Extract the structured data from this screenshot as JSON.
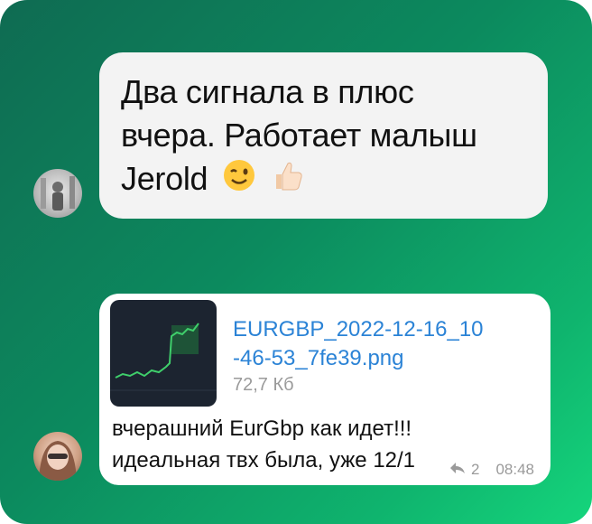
{
  "messages": [
    {
      "text_lines": [
        "Два сигнала в плюс",
        "вчера. Работает малыш",
        "Jerold"
      ],
      "emojis": [
        "winking-face-icon",
        "thumbs-up-icon"
      ]
    },
    {
      "attachment": {
        "file_name_lines": [
          "EURGBP_2022-12-16_10",
          "-46-53_7fe39.png"
        ],
        "file_size": "72,7 Кб"
      },
      "text_lines": [
        "вчерашний EurGbp как идет!!!",
        "идеальная твх была, уже 12/1"
      ],
      "replies_count": "2",
      "time": "08:48"
    }
  ],
  "colors": {
    "background_start": "#0f6b52",
    "background_end": "#15d57c",
    "bubble": "#f3f3f3",
    "link": "#2b83d6"
  }
}
